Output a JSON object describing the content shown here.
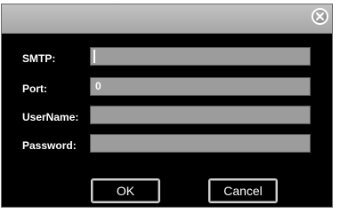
{
  "dialog": {
    "fields": [
      {
        "label": "SMTP:",
        "value": ""
      },
      {
        "label": "Port:",
        "value": "0"
      },
      {
        "label": "UserName:",
        "value": ""
      },
      {
        "label": "Password:",
        "value": ""
      }
    ],
    "ok_label": "OK",
    "cancel_label": "Cancel",
    "close_icon": "close-icon"
  },
  "colors": {
    "titlebar": "#b0b0b0",
    "body": "#000000",
    "field": "#9c9c9c",
    "text": "#ffffff"
  }
}
